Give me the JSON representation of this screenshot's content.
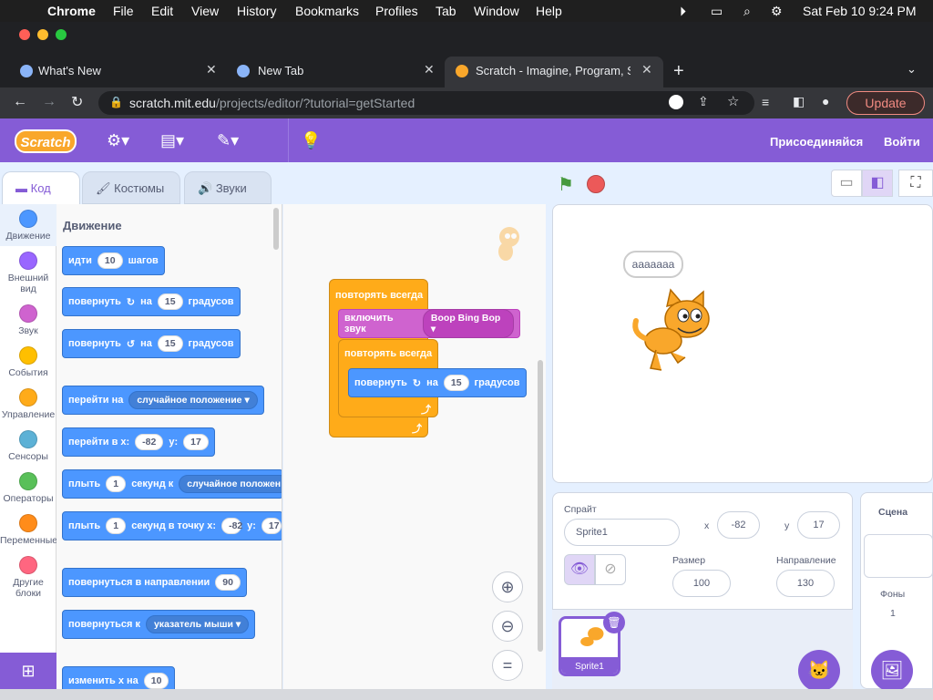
{
  "macos_menubar": {
    "app": "Chrome",
    "items": [
      "File",
      "Edit",
      "View",
      "History",
      "Bookmarks",
      "Profiles",
      "Tab",
      "Window",
      "Help"
    ],
    "clock": "Sat Feb 10  9:24 PM"
  },
  "browser": {
    "tabs": [
      {
        "title": "What's New"
      },
      {
        "title": "New Tab"
      },
      {
        "title": "Scratch - Imagine, Program, Sh"
      }
    ],
    "url_host": "scratch.mit.edu",
    "url_path": "/projects/editor/?tutorial=getStarted",
    "update_label": "Update"
  },
  "scratch_menu": {
    "logo_text": "Scratch",
    "join": "Присоединяйся",
    "signin": "Войти"
  },
  "editor_tabs": {
    "code": "Код",
    "costumes": "Костюмы",
    "sounds": "Звуки"
  },
  "categories": [
    {
      "label": "Движение",
      "color": "#4c97ff"
    },
    {
      "label": "Внешний вид",
      "color": "#9966ff"
    },
    {
      "label": "Звук",
      "color": "#cf63cf"
    },
    {
      "label": "События",
      "color": "#ffbf00"
    },
    {
      "label": "Управление",
      "color": "#ffab19"
    },
    {
      "label": "Сенсоры",
      "color": "#5cb1d6"
    },
    {
      "label": "Операторы",
      "color": "#59c059"
    },
    {
      "label": "Переменные",
      "color": "#ff8c1a"
    },
    {
      "label": "Другие блоки",
      "color": "#ff6680"
    }
  ],
  "palette": {
    "heading": "Движение",
    "move": {
      "a": "идти",
      "n": "10",
      "b": "шагов"
    },
    "turn_right": {
      "a": "повернуть",
      "b": "на",
      "n": "15",
      "c": "градусов"
    },
    "turn_left": {
      "a": "повернуть",
      "b": "на",
      "n": "15",
      "c": "градусов"
    },
    "goto": {
      "a": "перейти на",
      "dd": "случайное положение"
    },
    "goto_xy": {
      "a": "перейти в x:",
      "x": "-82",
      "b": "y:",
      "y": "17"
    },
    "glide_to": {
      "a": "плыть",
      "n": "1",
      "b": "секунд к",
      "dd": "случайное положен"
    },
    "glide_xy": {
      "a": "плыть",
      "n": "1",
      "b": "секунд в точку x:",
      "x": "-82",
      "c": "y:",
      "y": "17"
    },
    "point_dir": {
      "a": "повернуться в направлении",
      "n": "90"
    },
    "point_to": {
      "a": "повернуться к",
      "dd": "указатель мыши"
    },
    "change_x": {
      "a": "изменить х на",
      "n": "10"
    }
  },
  "script": {
    "forever_outer": "повторять всегда",
    "play_sound": "включить звук",
    "sound_name": "Boop Bing Bop",
    "forever_inner": "повторять всегда",
    "turn": {
      "a": "повернуть",
      "b": "на",
      "n": "15",
      "c": "градусов"
    }
  },
  "stage": {
    "speech": "ааааааа"
  },
  "sprite_info": {
    "label": "Спрайт",
    "name": "Sprite1",
    "x_label": "x",
    "x": "-82",
    "y_label": "y",
    "y": "17",
    "size_label": "Размер",
    "size": "100",
    "direction_label": "Направление",
    "direction": "130",
    "thumb_name": "Sprite1"
  },
  "stage_panel": {
    "title": "Сцена",
    "backdrops_label": "Фоны",
    "backdrops_count": "1"
  }
}
